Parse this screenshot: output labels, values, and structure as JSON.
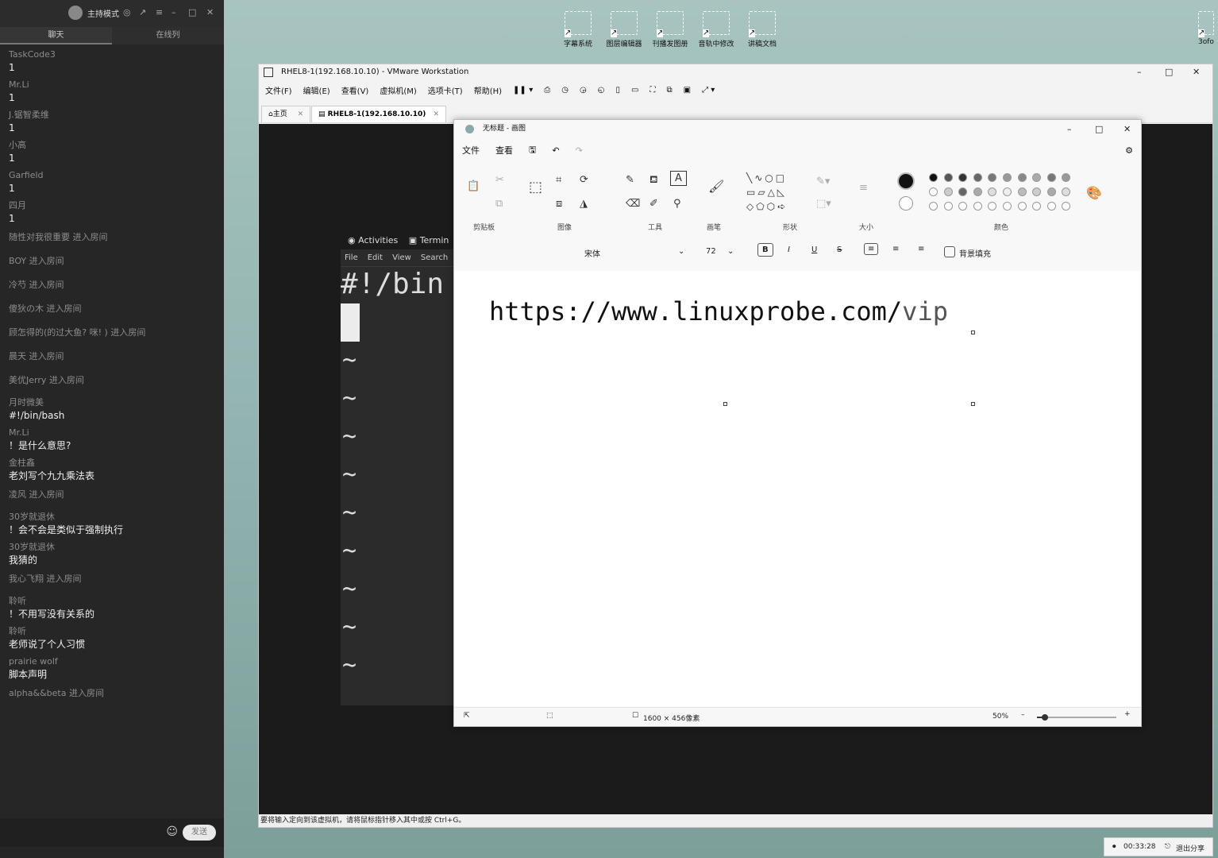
{
  "desktop": {
    "icons": [
      "字幕系统",
      "图层编辑器",
      "刊播发图册",
      "音轨中修改",
      "讲稿文档"
    ],
    "right_icon": "3ofo"
  },
  "chat": {
    "title": "主持模式",
    "tabs": [
      "聊天",
      "在线列"
    ],
    "items": [
      {
        "name": "TaskCode3",
        "text": "1"
      },
      {
        "name": "Mr.Li",
        "text": "1"
      },
      {
        "name": "J.锯智柔维",
        "text": "1"
      },
      {
        "name": "小高",
        "text": "1"
      },
      {
        "name": "Garfield",
        "text": "1"
      },
      {
        "name": "四月",
        "text": "1"
      },
      {
        "sys": "随性对我很重要 进入房间"
      },
      {
        "sys": "BOY 进入房间"
      },
      {
        "sys": "冷芍 进入房间"
      },
      {
        "sys": "傻狄の木 进入房间"
      },
      {
        "sys": "顾怎得的(的过大鱼? 咪! ) 进入房间"
      },
      {
        "sys": "晨天 进入房间"
      },
      {
        "sys": "美优Jerry 进入房间"
      },
      {
        "name": "月时微美",
        "text": "#!/bin/bash"
      },
      {
        "name": "Mr.Li",
        "text": "！是什么意思?"
      },
      {
        "name": "金柱鑫",
        "text": "老刘写个九九乘法表"
      },
      {
        "sys": "凌风 进入房间"
      },
      {
        "name": "30岁就退休",
        "text": "！会不会是类似于强制执行"
      },
      {
        "name": "30岁就退休",
        "text": "我猜的"
      },
      {
        "sys": "我心飞翔 进入房间"
      },
      {
        "name": "聆听",
        "text": "！不用写没有关系的"
      },
      {
        "name": "聆听",
        "text": "老师说了个人习惯"
      },
      {
        "name": "prairie wolf",
        "text": "脚本声明"
      },
      {
        "sys": "alpha&&beta 进入房间"
      }
    ],
    "send_label": "发送"
  },
  "vmware": {
    "title": "RHEL8-1(192.168.10.10) - VMware Workstation",
    "menu": [
      "文件(F)",
      "编辑(E)",
      "查看(V)",
      "虚拟机(M)",
      "选项卡(T)",
      "帮助(H)"
    ],
    "tab_home": "主页",
    "tab_vm": "RHEL8-1(192.168.10.10)",
    "status": "要将输入定向到该虚拟机，请将鼠标指针移入其中或按 Ctrl+G。"
  },
  "gnome": {
    "activities": "Activities",
    "terminal": "Termin"
  },
  "terminal": {
    "menu": [
      "File",
      "Edit",
      "View",
      "Search"
    ],
    "line": "#!/bin",
    "tilde": "~"
  },
  "paint": {
    "title": "无标题 - 画图",
    "menu": [
      "文件",
      "查看"
    ],
    "groups": [
      "剪贴板",
      "图像",
      "工具",
      "画笔",
      "形状",
      "大小",
      "颜色"
    ],
    "font": "宋体",
    "size": "72",
    "bg_fill": "背景填充",
    "canvas_text": "https://www.linuxprobe.com/",
    "canvas_tail": "vip",
    "dimensions": "1600 × 456像素",
    "zoom": "50%",
    "zoom_fraction": 0.1
  },
  "share": {
    "timer": "00:33:28",
    "exit": "退出分享"
  }
}
